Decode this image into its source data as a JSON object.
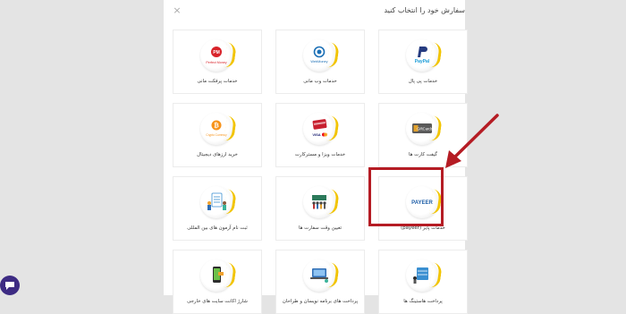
{
  "header": {
    "title": "سفارش خود را انتخاب کنید",
    "close_symbol": "×"
  },
  "services": [
    {
      "label": "خدمات پرفکت مانی",
      "logo_text": "Perfect Money",
      "icon": "perfect-money-icon"
    },
    {
      "label": "خدمات وب مانی",
      "logo_text": "WebMoney",
      "icon": "webmoney-icon"
    },
    {
      "label": "خدمات پی پال",
      "logo_text": "PayPal",
      "icon": "paypal-icon"
    },
    {
      "label": "خرید ارزهای دیجیتال",
      "logo_text": "Crypto Currency",
      "icon": "bitcoin-icon"
    },
    {
      "label": "خدمات ویزا و مسترکارت",
      "logo_text": "VISA",
      "icon": "credit-card-icon"
    },
    {
      "label": "گیفت کارت ها",
      "logo_text": "GiftCards",
      "icon": "gift-card-icon"
    },
    {
      "label": "ثبت نام آزمون های بین المللی",
      "logo_text": "",
      "icon": "exam-clipboard-icon"
    },
    {
      "label": "تعیین وقت سفارت ها",
      "logo_text": "",
      "icon": "embassy-people-icon"
    },
    {
      "label": "خدمات پایر (payeer)",
      "logo_text": "PAYEER",
      "icon": "payeer-icon"
    },
    {
      "label": "شارژ اکانت سایت های خارجی",
      "logo_text": "",
      "icon": "phone-recharge-icon"
    },
    {
      "label": "پرداخت های برنامه نویسان و طراحان",
      "logo_text": "",
      "icon": "laptop-code-icon"
    },
    {
      "label": "پرداخت هاستینگ ها",
      "logo_text": "",
      "icon": "hosting-server-icon"
    }
  ],
  "colors": {
    "accent_ring": "#f2c400",
    "highlight": "#b51c24",
    "chat": "#3d2b83"
  }
}
